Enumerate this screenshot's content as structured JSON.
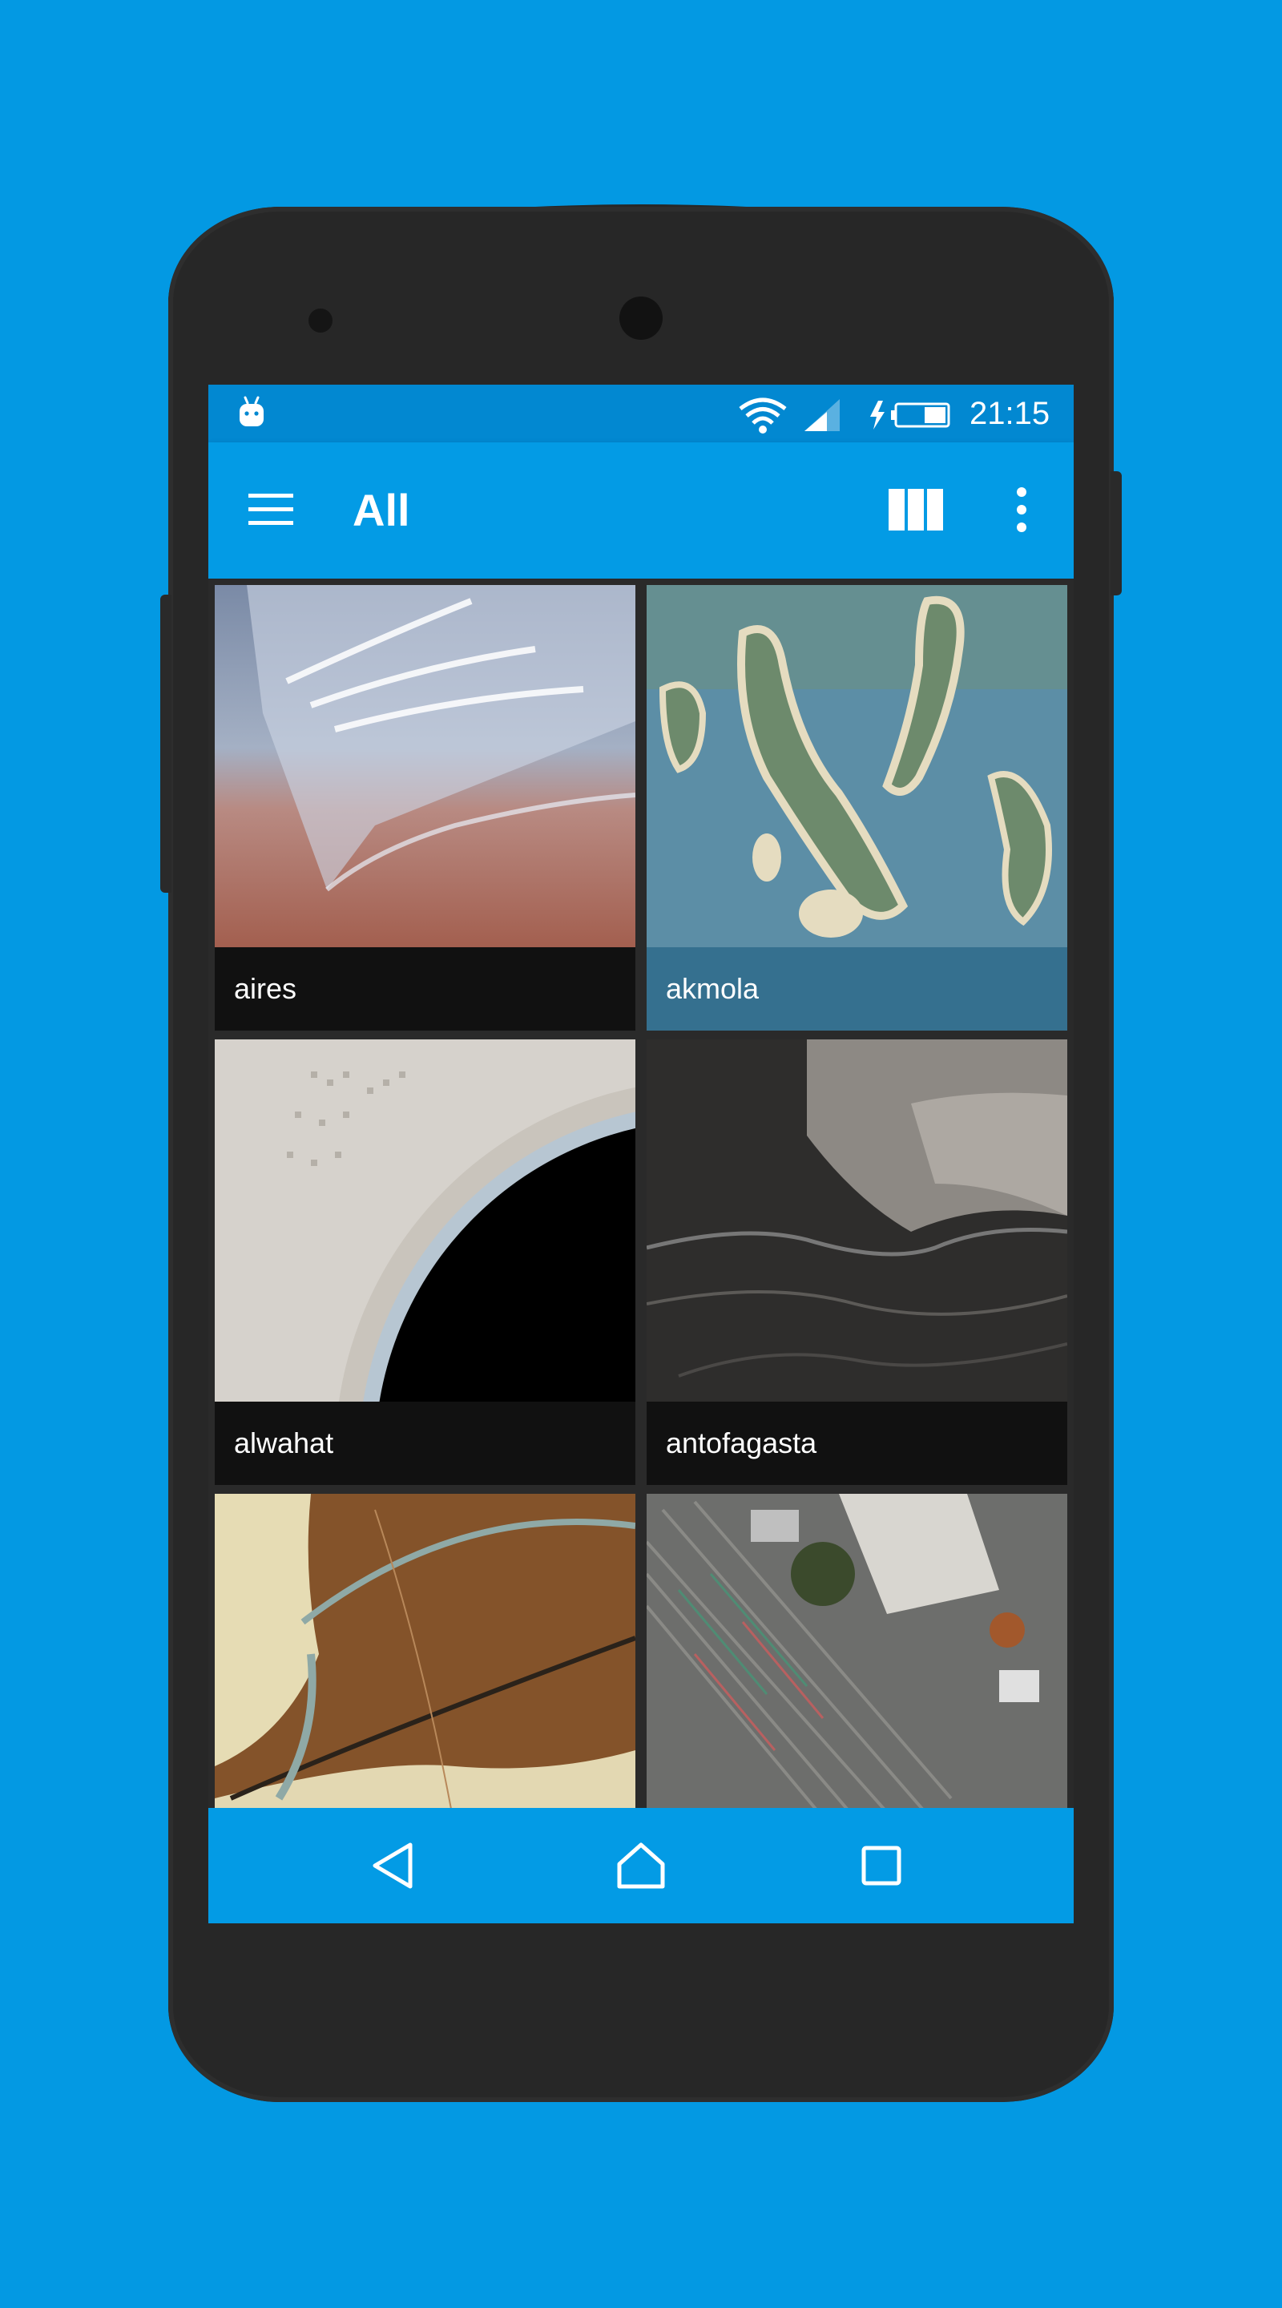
{
  "background_color": "#0399e3",
  "status_bar": {
    "time": "21:15",
    "icons": [
      "android-icon",
      "wifi-icon",
      "signal-icon",
      "charging-battery-icon"
    ]
  },
  "app_bar": {
    "title": "All",
    "menu_icon": "hamburger-menu-icon",
    "view_icon": "column-view-icon",
    "overflow_icon": "more-vertical-icon",
    "color": "#039be5"
  },
  "gallery": {
    "items": [
      {
        "label": "aires",
        "selected": false
      },
      {
        "label": "akmola",
        "selected": true
      },
      {
        "label": "alwahat",
        "selected": false
      },
      {
        "label": "antofagasta",
        "selected": false
      },
      {
        "label": "",
        "selected": false
      },
      {
        "label": "",
        "selected": false
      }
    ],
    "selected_caption_color": "#35708f"
  },
  "nav_bar": {
    "buttons": [
      "back-icon",
      "home-icon",
      "recents-icon"
    ]
  }
}
